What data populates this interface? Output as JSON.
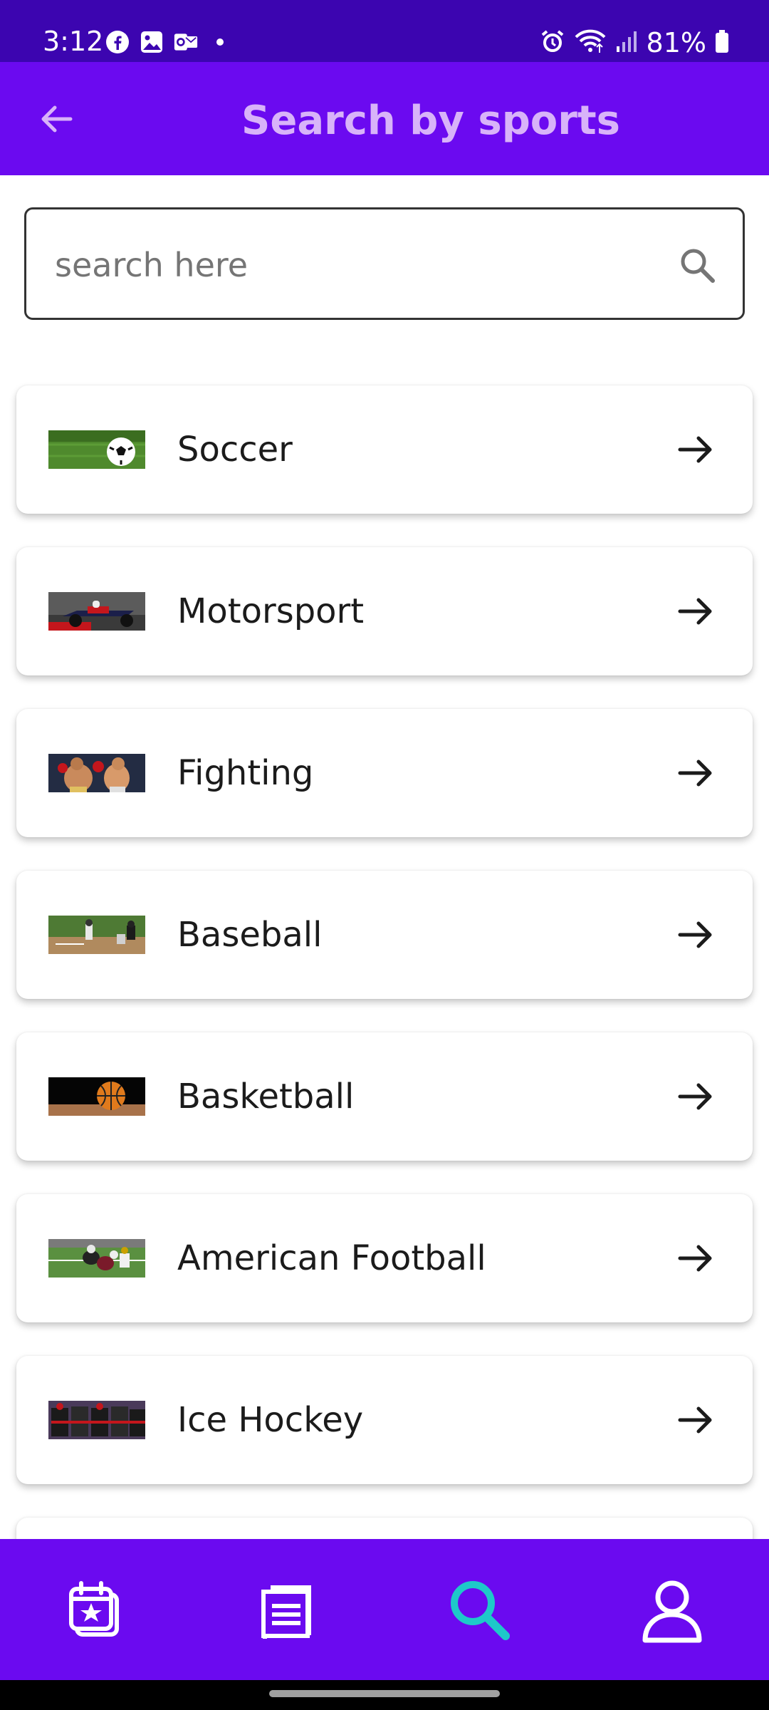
{
  "status": {
    "time": "3:12",
    "battery": "81%"
  },
  "header": {
    "title": "Search by sports"
  },
  "search": {
    "placeholder": "search here",
    "value": ""
  },
  "sports": [
    {
      "label": "Soccer"
    },
    {
      "label": "Motorsport"
    },
    {
      "label": "Fighting"
    },
    {
      "label": "Baseball"
    },
    {
      "label": "Basketball"
    },
    {
      "label": "American Football"
    },
    {
      "label": "Ice Hockey"
    }
  ],
  "nav": {
    "items": [
      {
        "icon": "calendar-star-icon"
      },
      {
        "icon": "news-list-icon"
      },
      {
        "icon": "search-icon",
        "active": true
      },
      {
        "icon": "profile-icon"
      }
    ]
  },
  "colors": {
    "status_bar": "#3c05b0",
    "primary": "#6b0af0",
    "title": "#d8b3f9",
    "active_nav": "#1ec9c9"
  }
}
